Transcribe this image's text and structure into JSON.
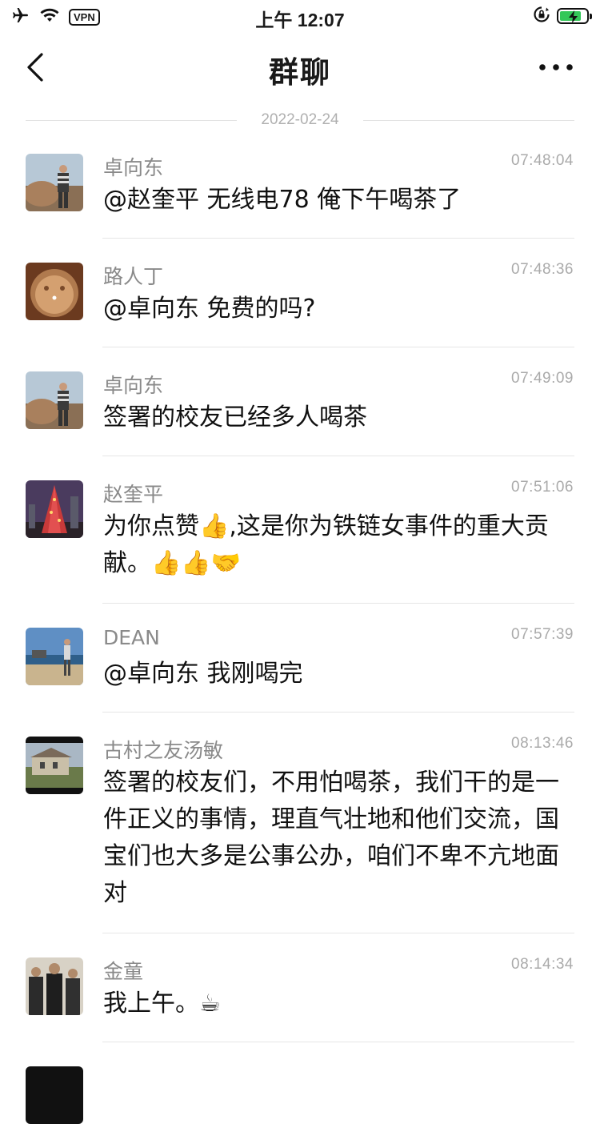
{
  "status_bar": {
    "vpn": "VPN",
    "time": "上午 12:07"
  },
  "nav": {
    "title": "群聊"
  },
  "date_separator": "2022-02-24",
  "messages": [
    {
      "name": "卓向东",
      "time": "07:48:04",
      "text": "@赵奎平 无线电78 俺下午喝茶了",
      "avatar": "avatar-zhuo"
    },
    {
      "name": "路人丁",
      "time": "07:48:36",
      "text": "@卓向东 免费的吗?",
      "avatar": "avatar-luren"
    },
    {
      "name": "卓向东",
      "time": "07:49:09",
      "text": "签署的校友已经多人喝茶",
      "avatar": "avatar-zhuo"
    },
    {
      "name": "赵奎平",
      "time": "07:51:06",
      "text": "为你点赞👍,这是你为铁链女事件的重大贡献。👍👍🤝",
      "avatar": "avatar-zhao"
    },
    {
      "name": "DEAN",
      "time": "07:57:39",
      "text": "@卓向东 我刚喝完",
      "avatar": "avatar-dean"
    },
    {
      "name": "古村之友汤敏",
      "time": "08:13:46",
      "text": "签署的校友们，不用怕喝茶，我们干的是一件正义的事情，理直气壮地和他们交流，国宝们也大多是公事公办，咱们不卑不亢地面对",
      "avatar": "avatar-tang"
    },
    {
      "name": "金童",
      "time": "08:14:34",
      "text": "我上午。☕",
      "avatar": "avatar-jin"
    }
  ],
  "colors": {
    "battery": "#34c759",
    "name_text": "#8a8a8a",
    "time_text": "#aaaaaa"
  }
}
